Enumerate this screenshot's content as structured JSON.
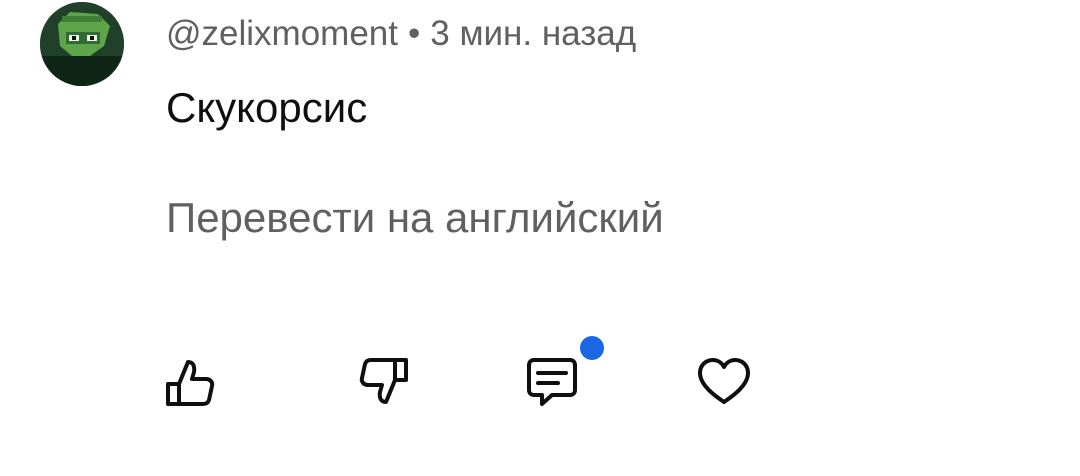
{
  "comment": {
    "author": "@zelixmoment",
    "separator": "•",
    "time": "3 мин. назад",
    "text": "Скукорсис",
    "translate_label": "Перевести на английский"
  },
  "actions": {
    "like_icon": "thumbs-up-icon",
    "dislike_icon": "thumbs-down-icon",
    "reply_icon": "comment-bubble-icon",
    "heart_icon": "heart-icon"
  },
  "colors": {
    "notification_dot": "#1a66e5",
    "secondary_text": "#606060",
    "primary_text": "#0f0f0f"
  }
}
